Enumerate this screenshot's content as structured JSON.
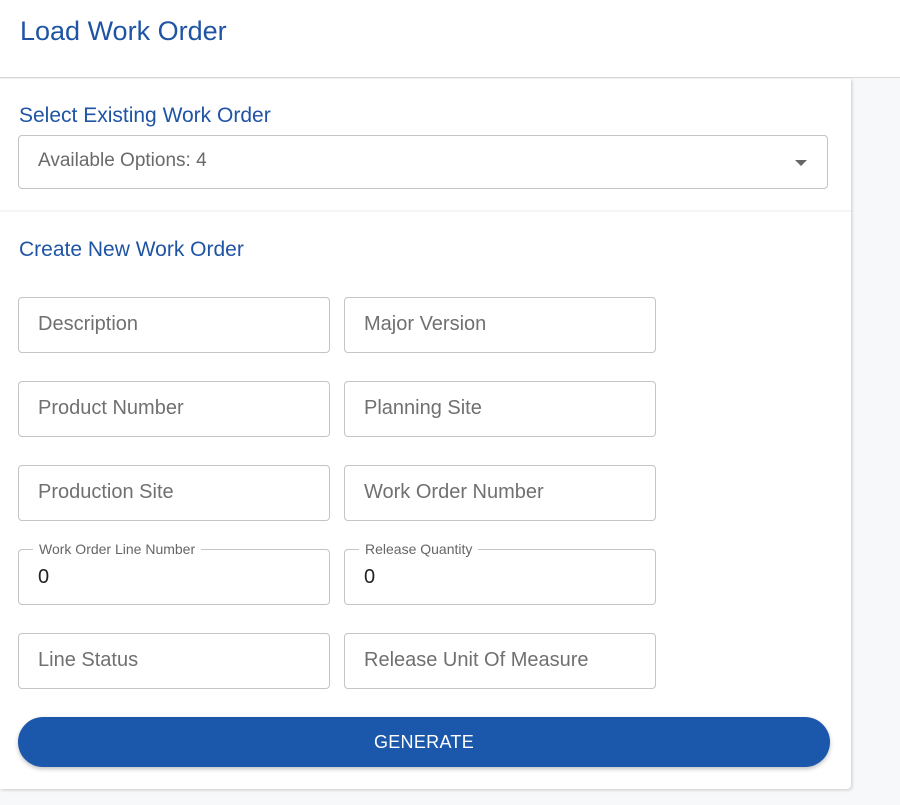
{
  "header": {
    "title": "Load Work Order"
  },
  "existing": {
    "title": "Select Existing Work Order",
    "select_value": "Available Options: 4"
  },
  "create": {
    "title": "Create New Work Order",
    "fields": {
      "description": {
        "placeholder": "Description"
      },
      "major_version": {
        "placeholder": "Major Version"
      },
      "product_number": {
        "placeholder": "Product Number"
      },
      "planning_site": {
        "placeholder": "Planning Site"
      },
      "production_site": {
        "placeholder": "Production Site"
      },
      "work_order_number": {
        "placeholder": "Work Order Number"
      },
      "work_order_line_number": {
        "label": "Work Order Line Number",
        "value": "0"
      },
      "release_quantity": {
        "label": "Release Quantity",
        "value": "0"
      },
      "line_status": {
        "placeholder": "Line Status"
      },
      "release_unit_of_measure": {
        "placeholder": "Release Unit Of Measure"
      }
    },
    "generate_label": "GENERATE"
  },
  "colors": {
    "accent": "#1f54a4",
    "button": "#1b57ab"
  }
}
